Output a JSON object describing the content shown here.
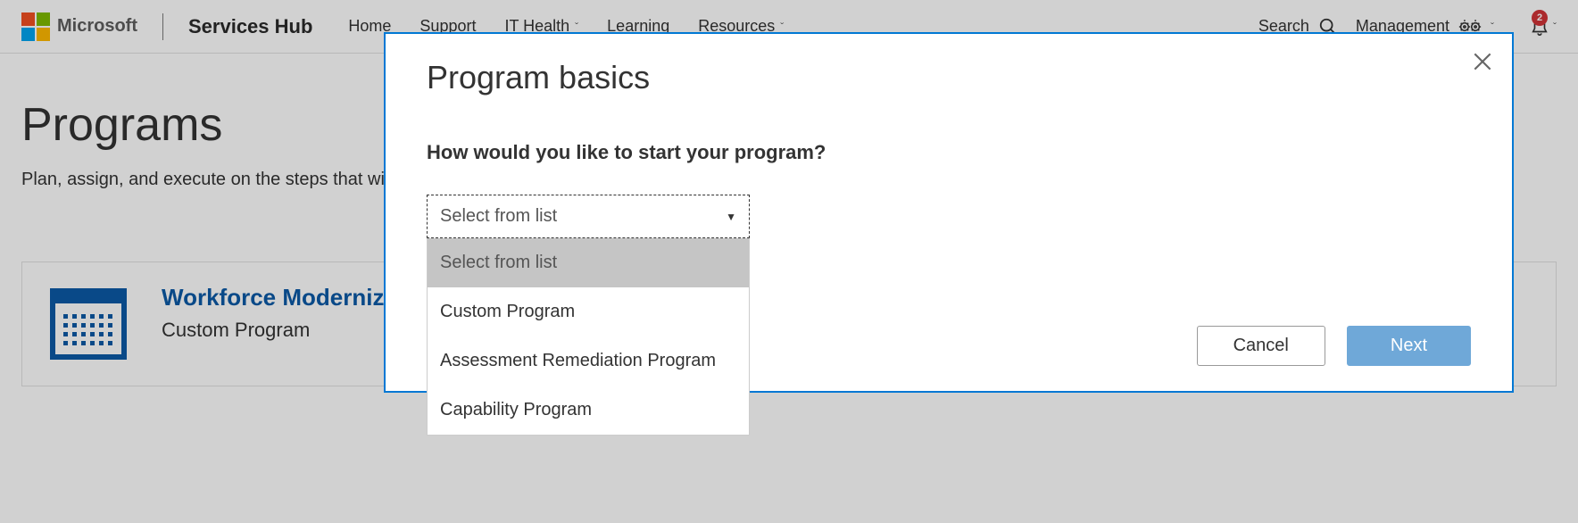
{
  "header": {
    "brand": "Microsoft",
    "hub_title": "Services Hub",
    "nav": {
      "home": "Home",
      "support": "Support",
      "it_health": "IT Health",
      "learning": "Learning",
      "resources": "Resources"
    },
    "search_label": "Search",
    "management_label": "Management",
    "notification_count": "2"
  },
  "page": {
    "title": "Programs",
    "subtitle": "Plan, assign, and execute on the steps that will help you reach your goals.",
    "card": {
      "name": "Workforce Modernization with Microsoft Teams",
      "type": "Custom Program"
    }
  },
  "modal": {
    "title": "Program basics",
    "question": "How would you like to start your program?",
    "select_placeholder": "Select from list",
    "options": {
      "placeholder": "Select from list",
      "custom": "Custom Program",
      "assessment": "Assessment Remediation Program",
      "capability": "Capability Program"
    },
    "cancel_label": "Cancel",
    "next_label": "Next"
  }
}
